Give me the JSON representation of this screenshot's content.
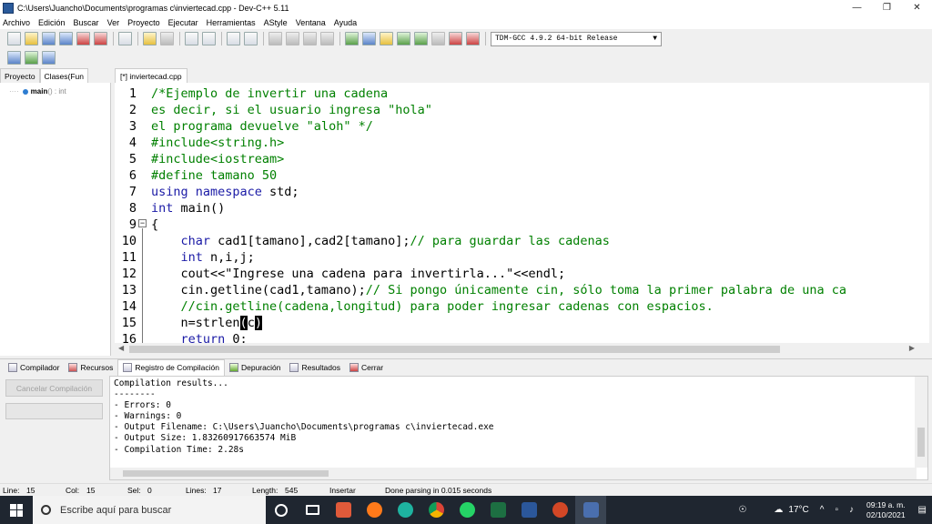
{
  "window": {
    "title": "C:\\Users\\Juancho\\Documents\\programas c\\inviertecad.cpp - Dev-C++ 5.11"
  },
  "menu": [
    "Archivo",
    "Edición",
    "Buscar",
    "Ver",
    "Proyecto",
    "Ejecutar",
    "Herramientas",
    "AStyle",
    "Ventana",
    "Ayuda"
  ],
  "toolbar": {
    "compiler": "TDM-GCC 4.9.2 64-bit Release"
  },
  "left_tabs": [
    "Proyecto",
    "Clases(Fun"
  ],
  "class_tree": {
    "name": "main",
    "type": "() : int"
  },
  "file_tab": "[*] inviertecad.cpp",
  "editor": {
    "line_numbers": [
      "1",
      "2",
      "3",
      "4",
      "5",
      "6",
      "7",
      "8",
      "9",
      "10",
      "11",
      "12",
      "13",
      "14",
      "15",
      "16"
    ]
  },
  "bottom_tabs": [
    "Compilador",
    "Recursos",
    "Registro de Compilación",
    "Depuración",
    "Resultados",
    "Cerrar"
  ],
  "cancel_button": "Cancelar Compilación",
  "output": [
    "Compilation results...",
    "--------",
    "- Errors: 0",
    "- Warnings: 0",
    "- Output Filename: C:\\Users\\Juancho\\Documents\\programas c\\inviertecad.exe",
    "- Output Size: 1.83260917663574 MiB",
    "- Compilation Time: 2.28s"
  ],
  "status": {
    "line_label": "Line:",
    "line": "15",
    "col_label": "Col:",
    "col": "15",
    "sel_label": "Sel:",
    "sel": "0",
    "lines_label": "Lines:",
    "lines": "17",
    "length_label": "Length:",
    "length": "545",
    "mode": "Insertar",
    "message": "Done parsing in 0.015 seconds"
  },
  "taskbar": {
    "search_placeholder": "Escribe aquí para buscar",
    "temperature": "17°C",
    "time": "09:19 a. m.",
    "date": "02/10/2021"
  }
}
